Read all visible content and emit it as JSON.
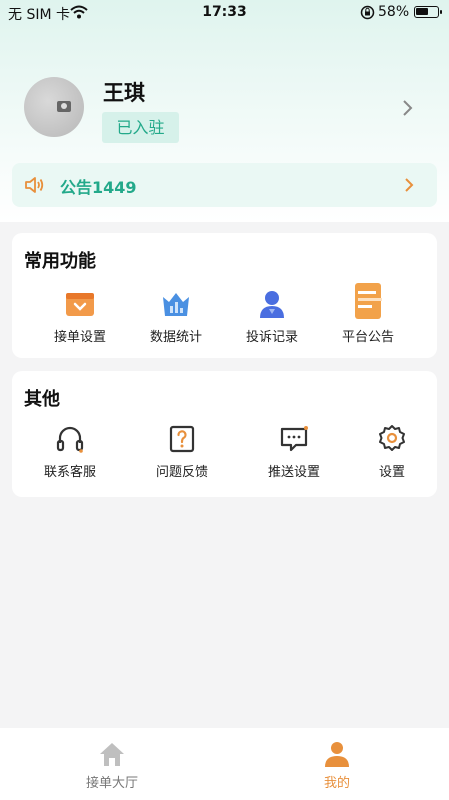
{
  "status_bar": {
    "carrier": "无 SIM 卡",
    "time": "17:33",
    "battery": "58%"
  },
  "profile": {
    "name": "王琪",
    "badge": "已入驻"
  },
  "notice": {
    "text": "公告1449"
  },
  "common_functions": {
    "title": "常用功能",
    "items": [
      {
        "label": "接单设置",
        "icon": "order-settings-icon"
      },
      {
        "label": "数据统计",
        "icon": "statistics-icon"
      },
      {
        "label": "投诉记录",
        "icon": "complaint-icon"
      },
      {
        "label": "平台公告",
        "icon": "platform-notice-icon"
      }
    ]
  },
  "other": {
    "title": "其他",
    "items": [
      {
        "label": "联系客服",
        "icon": "headset-icon"
      },
      {
        "label": "问题反馈",
        "icon": "question-icon"
      },
      {
        "label": "推送设置",
        "icon": "message-icon"
      },
      {
        "label": "设置",
        "icon": "gear-icon"
      }
    ]
  },
  "tabbar": {
    "items": [
      {
        "label": "接单大厅",
        "icon": "home-icon"
      },
      {
        "label": "我的",
        "icon": "person-icon"
      }
    ]
  },
  "colors": {
    "accent_green": "#23a98a",
    "accent_orange": "#e8903c",
    "badge_bg": "#d6f1ea"
  }
}
